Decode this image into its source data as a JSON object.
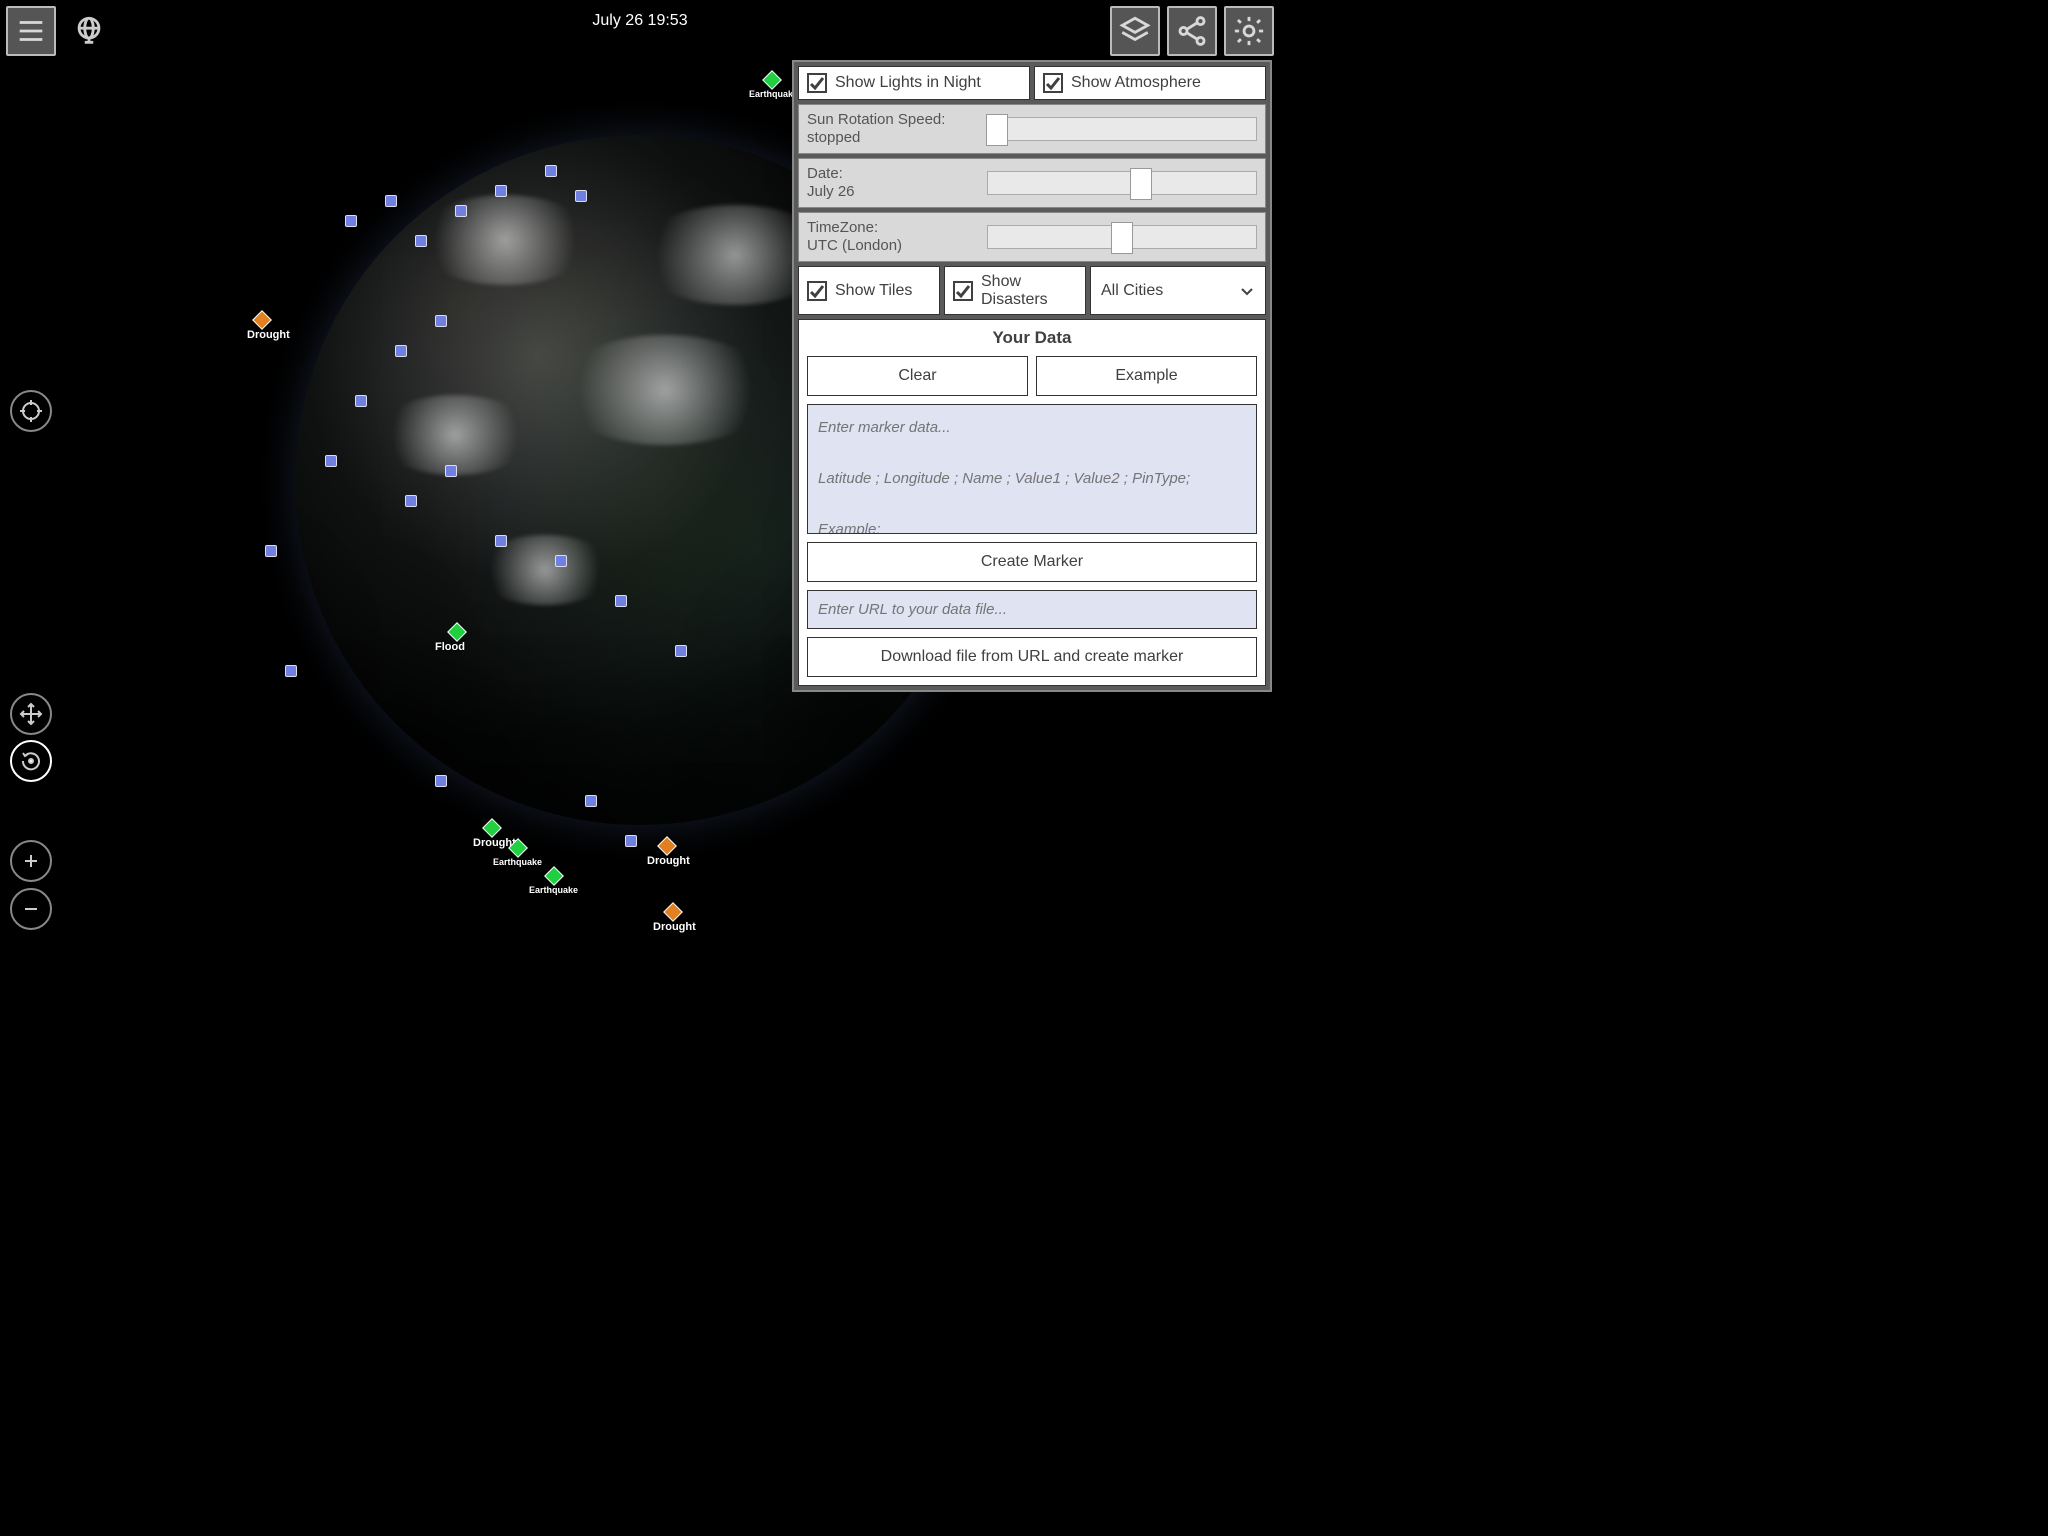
{
  "header": {
    "datetime": "July 26 19:53"
  },
  "panel": {
    "check_lights": "Show Lights in Night",
    "check_atmosphere": "Show Atmosphere",
    "sun_speed_label": "Sun Rotation Speed:\nstopped",
    "date_label": "Date:\nJuly 26",
    "tz_label": "TimeZone:\nUTC (London)",
    "check_tiles": "Show Tiles",
    "check_disasters": "Show Disasters",
    "city_select": "All Cities",
    "data_title": "Your Data",
    "btn_clear": "Clear",
    "btn_example": "Example",
    "marker_placeholder": "Enter marker data...\n\nLatitude ; Longitude ; Name ; Value1 ; Value2 ; PinType;\n\nExample:",
    "btn_create_marker": "Create Marker",
    "url_placeholder": "Enter URL to your data file...",
    "btn_download": "Download file from URL and create marker"
  },
  "disasters": {
    "drought1": "Drought",
    "drought2": "Drought",
    "drought3": "Drought",
    "drought4": "Drought",
    "flood": "Flood",
    "earthquake1": "Earthquake",
    "earthquake2": "Earthquake",
    "earthquake3": "Earthquake"
  }
}
